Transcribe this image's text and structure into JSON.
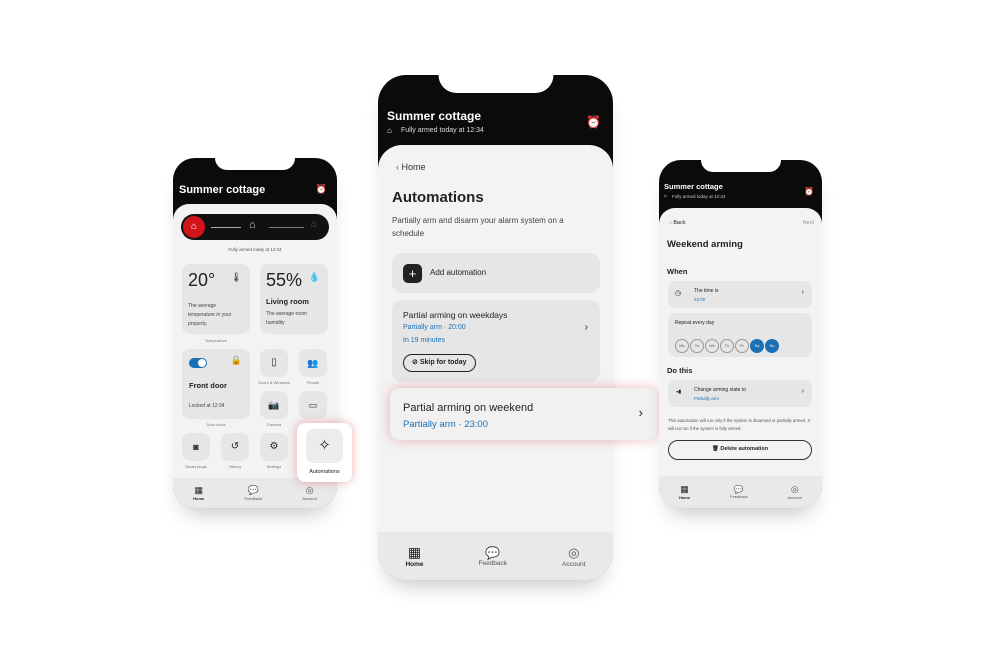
{
  "left": {
    "title": "Summer cottage",
    "status": "Fully armed today at 12:34",
    "temp": "20°",
    "temp_desc": "The average temperature in your property.",
    "temp_label": "Temperature",
    "humidity": "55%",
    "humidity_room": "Living room",
    "humidity_desc": "The average room humidity",
    "door_title": "Front door",
    "door_status": "Locked at 12:34",
    "door_label": "Door locks",
    "tiles": [
      "Doors & Windows",
      "People",
      "Camera",
      "Smart plugs",
      "History",
      "Settings"
    ],
    "automations": "Automations",
    "nav": [
      "Home",
      "Feedback",
      "Account"
    ]
  },
  "middle": {
    "title": "Summer cottage",
    "status": "Fully armed today at 12:34",
    "back": "Home",
    "heading": "Automations",
    "subtitle": "Partially arm and disarm your alarm system on a schedule",
    "add": "Add automation",
    "card1": {
      "title": "Partial arming on weekdays",
      "detail": "Partially arm · 20:00",
      "eta": "In 19 minutes",
      "skip": "Skip for today"
    },
    "card2": {
      "title": "Partial arming on weekend",
      "detail": "Partially arm · 23:00"
    },
    "nav": [
      "Home",
      "Feedback",
      "Account"
    ]
  },
  "right": {
    "title": "Summer cottage",
    "status": "Fully armed today at 12:34",
    "back": "Back",
    "next": "Next",
    "heading": "Weekend arming",
    "when": "When",
    "time_label": "The time is",
    "time": "22:00",
    "repeat": "Repeat every day",
    "days": [
      "Mo",
      "Tu",
      "We",
      "Th",
      "Fr",
      "Sa",
      "Su"
    ],
    "do_this": "Do this",
    "action": "Change arming state to",
    "action_value": "Partially arm",
    "note": "This automation will run only if the system is disarmed or partially armed. It will not run if the system is fully armed.",
    "delete": "Delete automation",
    "nav": [
      "Home",
      "Feedback",
      "Account"
    ]
  },
  "colors": {
    "accent": "#1a6fb5",
    "alarm": "#d0141b"
  }
}
